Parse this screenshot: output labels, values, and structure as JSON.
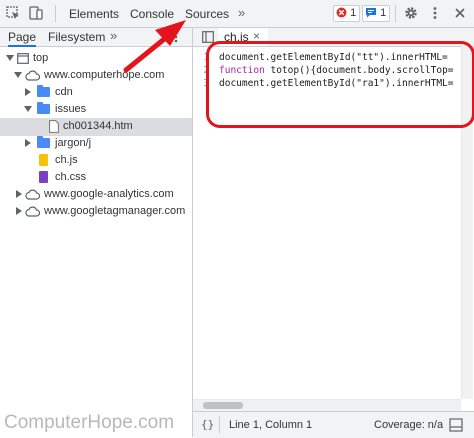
{
  "toolbar": {
    "tabs": [
      "Elements",
      "Console",
      "Sources"
    ],
    "more": "»",
    "error_count": "1",
    "message_count": "1",
    "icons": [
      "inspect-element-icon",
      "device-toggle-icon",
      "settings-gear-icon",
      "more-menu-icon",
      "close-icon"
    ]
  },
  "navigator": {
    "tabs": [
      "Page",
      "Filesystem"
    ],
    "more": "»",
    "tree": [
      {
        "label": "top",
        "icon": "frame-icon",
        "expanded": true
      },
      {
        "label": "www.computerhope.com",
        "icon": "cloud-icon",
        "expanded": true
      },
      {
        "label": "cdn",
        "icon": "folder-icon"
      },
      {
        "label": "issues",
        "icon": "folder-icon",
        "expanded": true
      },
      {
        "label": "ch001344.htm",
        "icon": "file-icon",
        "selected": true
      },
      {
        "label": "jargon/j",
        "icon": "folder-icon"
      },
      {
        "label": "ch.js",
        "icon": "js-file-icon"
      },
      {
        "label": "ch.css",
        "icon": "css-file-icon"
      },
      {
        "label": "www.google-analytics.com",
        "icon": "cloud-icon"
      },
      {
        "label": "www.googletagmanager.com",
        "icon": "cloud-icon"
      }
    ]
  },
  "editor": {
    "tab_label": "ch.js",
    "close": "×",
    "lines": [
      {
        "num": "1",
        "text": "document.getElementById(\"tt\").innerHTML="
      },
      {
        "num": "2",
        "kw": "function",
        "text": " totop(){document.body.scrollTop="
      },
      {
        "num": "3",
        "text": "document.getElementById(\"ra1\").innerHTML="
      }
    ]
  },
  "status": {
    "braces": "{}",
    "position": "Line 1, Column 1",
    "coverage": "Coverage: n/a"
  },
  "watermark": "ComputerHope.com",
  "colors": {
    "annotation_red": "#e3141b",
    "accent_blue": "#1a73e8",
    "folder_blue": "#4a8af4",
    "js_yellow": "#f4c20d",
    "css_purple": "#7b3fbf",
    "error_red": "#d93025",
    "message_blue": "#1a73e8"
  }
}
